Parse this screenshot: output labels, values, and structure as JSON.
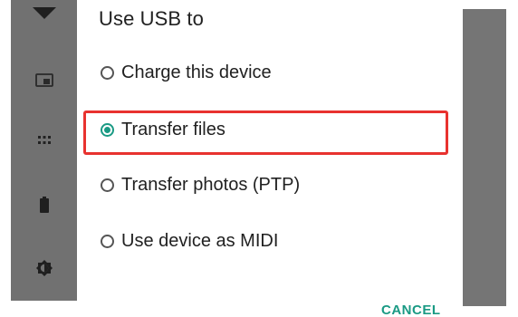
{
  "dialog": {
    "title": "Use USB to",
    "options": [
      {
        "label": "Charge this device",
        "selected": false
      },
      {
        "label": "Transfer files",
        "selected": true
      },
      {
        "label": "Transfer photos (PTP)",
        "selected": false
      },
      {
        "label": "Use device as MIDI",
        "selected": false
      }
    ],
    "cancel_label": "CANCEL"
  },
  "background_icons": [
    "chevron-down-icon",
    "cast-icon",
    "apps-grid-icon",
    "battery-icon",
    "brightness-icon"
  ],
  "colors": {
    "accent": "#1a9a84",
    "highlight": "#e8322f",
    "scrim": "#717171"
  }
}
